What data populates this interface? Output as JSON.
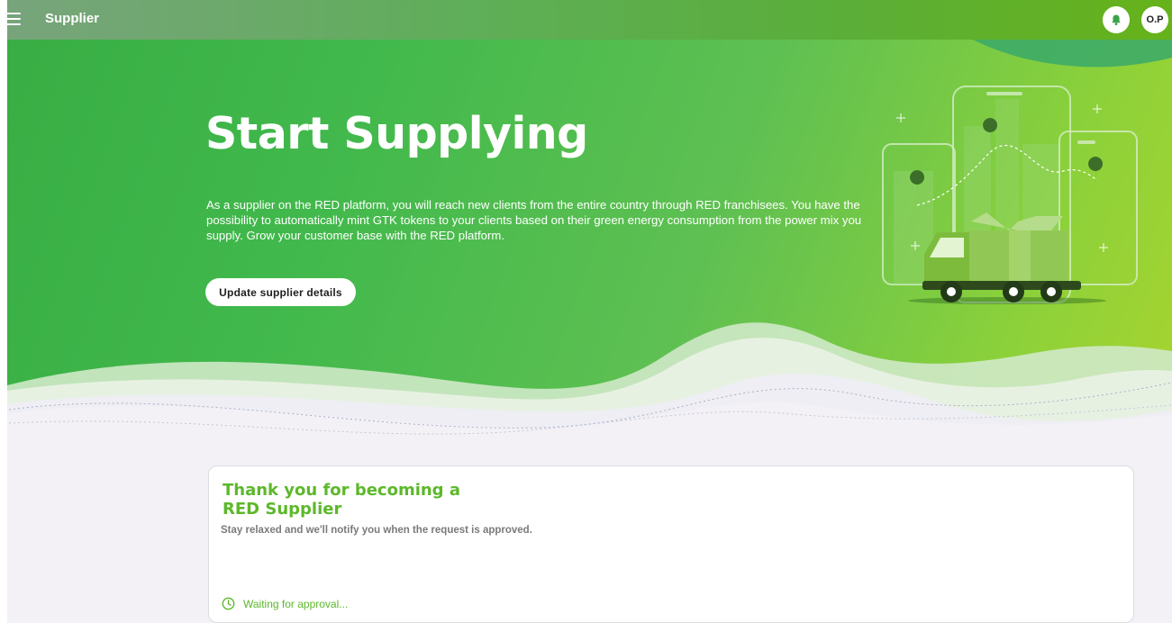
{
  "header": {
    "title": "Supplier",
    "avatar_initials": "O.P",
    "menu_icon": "hamburger-icon",
    "notification_icon": "bell-icon"
  },
  "hero": {
    "title": "Start Supplying",
    "description": "As a supplier on the RED platform, you will reach new clients from the entire country through RED franchisees. You have the possibility to automatically mint GTK tokens to your clients based on their green energy consumption from the power mix you supply. Grow your customer base with the RED platform.",
    "button_label": "Update supplier details"
  },
  "card": {
    "title": "Thank you for becoming a RED Supplier",
    "subtitle": "Stay relaxed and we'll notify you when the request is approved.",
    "status": "Waiting for approval...",
    "status_icon": "clock-icon"
  },
  "colors": {
    "brand_green": "#5cb82a",
    "hero_start": "#37ad43",
    "hero_end": "#a8d42f",
    "page_bg": "#f3f1f6"
  }
}
